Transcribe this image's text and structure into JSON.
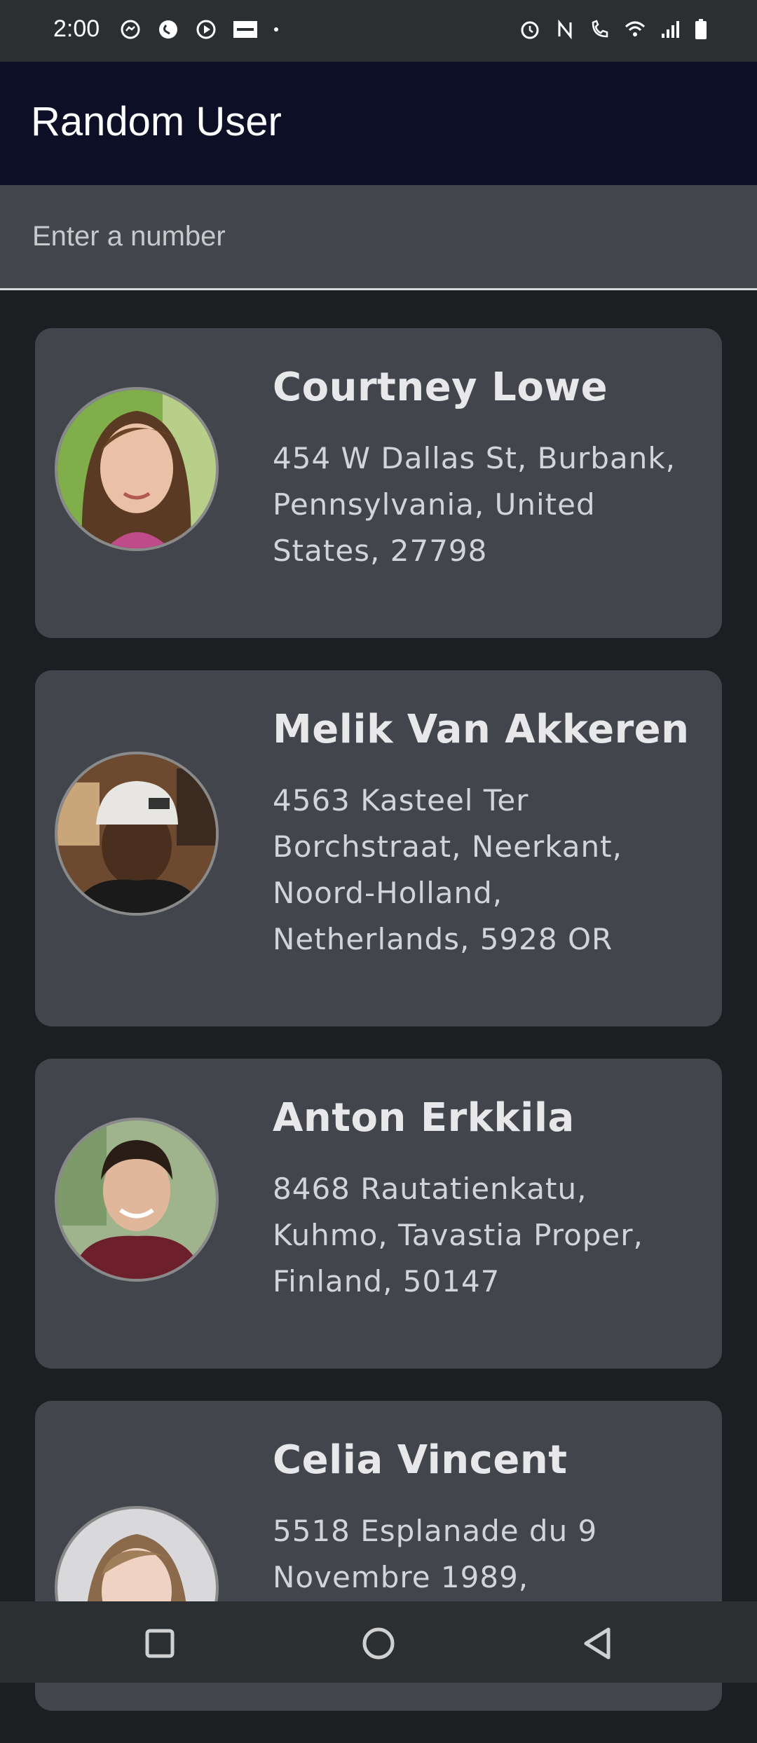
{
  "status_bar": {
    "time": "2:00",
    "left_icons": [
      "messenger-icon",
      "shazam-icon",
      "media-play-icon",
      "news-badge-icon",
      "dot-icon"
    ],
    "right_icons": [
      "alarm-icon",
      "nfc-icon",
      "call-icon",
      "wifi-icon",
      "signal-icon",
      "battery-icon"
    ]
  },
  "app_bar": {
    "title": "Random User"
  },
  "search": {
    "placeholder": "Enter a number",
    "value": ""
  },
  "users": [
    {
      "name": "Courtney Lowe",
      "address": "454 W Dallas St, Burbank, Pennsylvania, United States, 27798",
      "avatar_icon": "avatar-woman-brown-hair"
    },
    {
      "name": "Melik Van Akkeren",
      "address": "4563 Kasteel Ter Borchstraat, Neerkant, Noord-Holland, Netherlands, 5928 OR",
      "avatar_icon": "avatar-man-white-beanie"
    },
    {
      "name": "Anton Erkkila",
      "address": "8468 Rautatienkatu, Kuhmo, Tavastia Proper, Finland, 50147",
      "avatar_icon": "avatar-man-maroon-shirt"
    },
    {
      "name": "Celia Vincent",
      "address": "5518 Esplanade du 9 Novembre 1989,",
      "avatar_icon": "avatar-woman-blonde"
    }
  ],
  "nav_bar": {
    "buttons": [
      "recents-square-icon",
      "home-circle-icon",
      "back-triangle-icon"
    ]
  },
  "colors": {
    "app_bar_bg": "#0c0f26",
    "card_bg": "#42464c",
    "page_bg": "#1c1f22"
  }
}
